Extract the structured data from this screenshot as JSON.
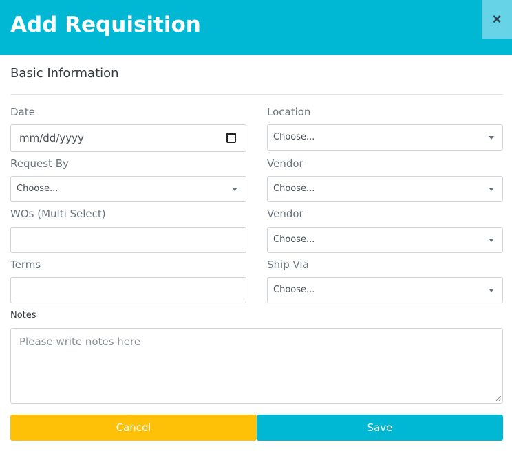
{
  "header": {
    "title": "Add Requisition",
    "close_label": "×"
  },
  "section": {
    "title": "Basic Information"
  },
  "fields": {
    "date": {
      "label": "Date",
      "value": "mm/dd/yyyy"
    },
    "location": {
      "label": "Location",
      "value": "Choose..."
    },
    "request_by": {
      "label": "Request By",
      "value": "Choose..."
    },
    "vendor1": {
      "label": "Vendor",
      "value": "Choose..."
    },
    "wos": {
      "label": "WOs (Multi Select)",
      "value": ""
    },
    "vendor2": {
      "label": "Vendor",
      "value": "Choose..."
    },
    "terms": {
      "label": "Terms",
      "value": ""
    },
    "ship_via": {
      "label": "Ship Via",
      "value": "Choose..."
    },
    "notes": {
      "label": "Notes",
      "placeholder": "Please write notes here"
    }
  },
  "buttons": {
    "cancel": "Cancel",
    "save": "Save"
  },
  "colors": {
    "header_bg": "#00b8d4",
    "cancel_bg": "#ffc107",
    "save_bg": "#00b8d4"
  }
}
